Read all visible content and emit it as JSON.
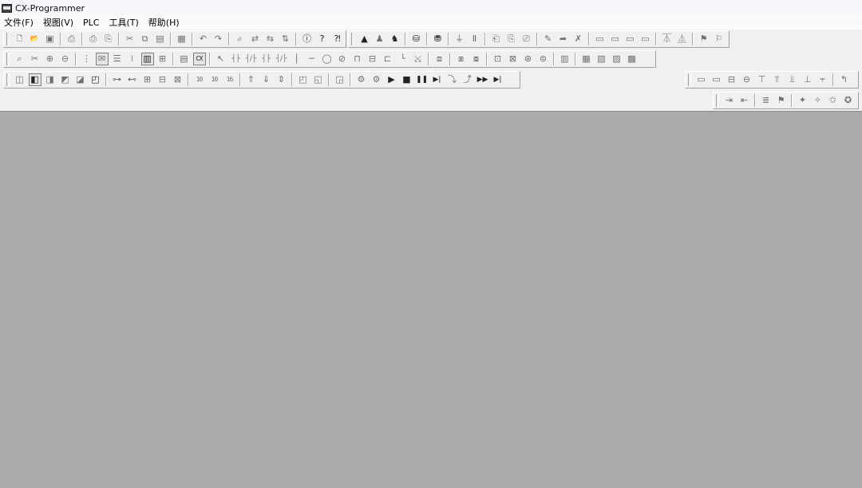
{
  "window": {
    "title": "CX-Programmer"
  },
  "menu": [
    "文件(F)",
    "视图(V)",
    "PLC",
    "工具(T)",
    "帮助(H)"
  ],
  "toolbars": [
    {
      "id": "standard",
      "row": 1,
      "groups": [
        [
          "new-file-icon",
          "open-folder-icon",
          "save-icon"
        ],
        [
          "print-preview-icon"
        ],
        [
          "print-icon",
          "print-setup-icon"
        ],
        [
          "cut-icon",
          "copy-icon",
          "paste-icon"
        ],
        [
          "delete-icon"
        ],
        [
          "undo-icon",
          "redo-icon"
        ],
        [
          "find-icon",
          "replace-icon",
          "cross-reference-icon",
          "address-reference-icon"
        ],
        [
          "about-icon",
          "help-icon",
          "context-help-icon"
        ]
      ]
    },
    {
      "id": "plc",
      "row": 1,
      "groups": [
        [
          "toggle-online-icon",
          "work-online-icon",
          "work-simulator-icon"
        ],
        [
          "connect-icon"
        ],
        [
          "transfer-plc-icon"
        ],
        [
          "monitor-icon",
          "pause-monitor-icon"
        ],
        [
          "transfer-to-plc-icon",
          "transfer-from-plc-icon",
          "compare-icon"
        ],
        [
          "online-edit-icon",
          "send-edit-icon",
          "cancel-edit-icon"
        ],
        [
          "program-mode-icon",
          "debug-mode-icon",
          "monitor-mode-icon",
          "run-mode-icon"
        ],
        [
          "force-on-icon",
          "force-off-icon"
        ],
        [
          "set-icon",
          "reset-icon"
        ]
      ]
    },
    {
      "id": "view",
      "row": 2,
      "groups": [
        [
          "zoom-icon",
          "cut-diagram-icon",
          "zoom-in-icon",
          "zoom-out-icon"
        ],
        [
          "grid-icon",
          "show-comment-icon",
          "list-icon",
          "properties-icon",
          "ladder-icon",
          "structure-icon"
        ],
        [
          "mnemonic-icon",
          "cx-icon"
        ],
        [
          "select-icon",
          "contact-icon",
          "contact-closed-icon",
          "contact-or-icon",
          "contact-or-closed-icon",
          "vertical-icon",
          "horizontal-icon",
          "coil-icon",
          "coil-closed-icon",
          "instruction-icon",
          "function-block-icon",
          "st-icon",
          "line-icon",
          "erase-line-icon"
        ],
        [
          "diff-icon"
        ],
        [
          "program-icon",
          "section-icon"
        ],
        [
          "rung-icon",
          "comment-rung-icon",
          "symbol-icon",
          "io-table-icon"
        ],
        [
          "compile-icon"
        ],
        [
          "memory-icon",
          "settings-icon",
          "error-log-icon",
          "cycle-time-icon"
        ]
      ]
    },
    {
      "id": "windows",
      "row": 3,
      "groups": [
        [
          "project-window-icon",
          "output-window-icon",
          "watch-window-icon",
          "address-window-icon",
          "symbol-window-icon",
          "properties-window-icon"
        ],
        [
          "dec-icon",
          "binary-icon",
          "hex-icon",
          "bcd-icon",
          "float-icon"
        ],
        [
          "base-10-icon",
          "base-10s-icon",
          "base-16-icon"
        ],
        [
          "transfer-up-icon",
          "transfer-down-icon",
          "transfer-merge-icon"
        ],
        [
          "data-trace-icon",
          "time-chart-icon"
        ],
        [
          "sim-icon"
        ],
        [
          "sim-break-icon",
          "sim-step-icon",
          "sim-run-icon",
          "sim-stop-icon",
          "sim-pause-icon",
          "sim-step-into-icon",
          "sim-step-over-icon",
          "sim-step-out-icon",
          "sim-fast-icon",
          "sim-end-icon"
        ]
      ]
    },
    {
      "id": "sfc",
      "row": 3,
      "groups": [
        [
          "sfc-step-icon",
          "sfc-transition-icon",
          "sfc-branch-icon",
          "sfc-converge-icon",
          "sfc-simultaneous-icon",
          "sfc-jump-icon",
          "sfc-parallel-icon",
          "sfc-merge-icon",
          "sfc-divergence-icon"
        ],
        [
          "sfc-return-icon"
        ]
      ]
    },
    {
      "id": "st",
      "row": 4,
      "groups": [
        [
          "indent-icon",
          "outdent-icon"
        ],
        [
          "align-icon",
          "bookmark-icon"
        ],
        [
          "toggle-bookmark-icon",
          "next-bookmark-icon",
          "prev-bookmark-icon",
          "clear-bookmark-icon"
        ]
      ]
    }
  ]
}
